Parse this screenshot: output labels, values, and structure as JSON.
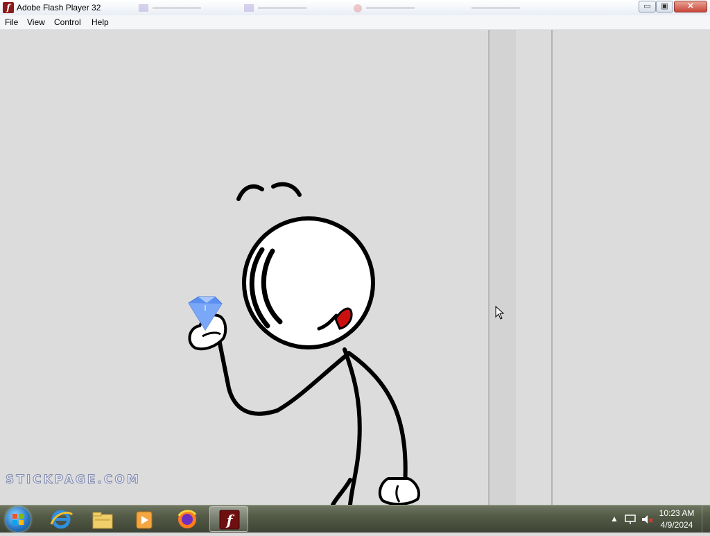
{
  "window": {
    "title": "Adobe Flash Player 32",
    "buttons": {
      "minimize": "▭",
      "restore": "▣",
      "close": "✕"
    }
  },
  "menu": {
    "items": [
      "File",
      "View",
      "Control",
      "Help"
    ]
  },
  "stage": {
    "watermark": "STICKPAGE.COM",
    "background_color": "#dcdcdc",
    "gem_color": "#5b8ff0"
  },
  "taskbar": {
    "pinned_icons": [
      "windows-start-icon",
      "internet-explorer-icon",
      "file-explorer-icon",
      "media-player-icon",
      "firefox-icon",
      "flash-player-icon"
    ],
    "active_app": "flash-player-icon",
    "clock": {
      "time": "10:23 AM",
      "date": "4/9/2024"
    },
    "tray_icons": [
      "show-hidden-icons-arrow",
      "network-icon",
      "volume-muted-icon"
    ]
  }
}
